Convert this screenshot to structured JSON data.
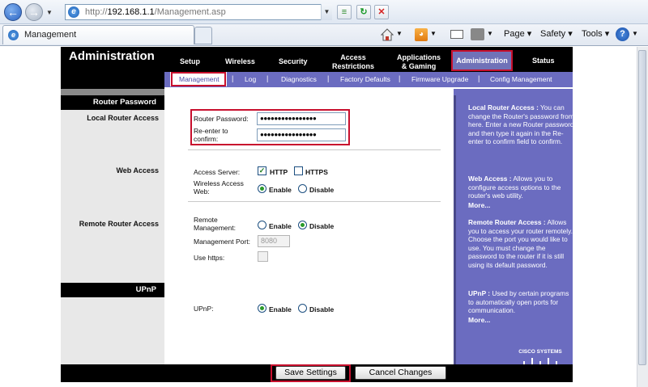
{
  "browser": {
    "address": "http://192.168.1.1/Management.asp",
    "address_host": "192.168.1.1",
    "address_prefix": "http://",
    "address_path": "/Management.asp",
    "tab_title": "Management",
    "menu": [
      "Page",
      "Safety",
      "Tools"
    ]
  },
  "page": {
    "title": "Administration",
    "nav": [
      {
        "label": "Setup"
      },
      {
        "label": "Wireless"
      },
      {
        "label": "Security"
      },
      {
        "label": "Access\nRestrictions"
      },
      {
        "label": "Applications\n& Gaming"
      },
      {
        "label": "Administration"
      },
      {
        "label": "Status"
      }
    ],
    "subnav": [
      "Management",
      "Log",
      "Diagnostics",
      "Factory Defaults",
      "Firmware Upgrade",
      "Config Management"
    ],
    "sections": {
      "router_password": "Router Password",
      "upnp": "UPnP"
    },
    "side_labels": {
      "local_access": "Local Router Access",
      "web_access": "Web Access",
      "remote_access": "Remote Router Access"
    },
    "form": {
      "router_password_label": "Router Password:",
      "router_password_value": "●●●●●●●●●●●●●●●●",
      "reenter_label": "Re-enter to confirm:",
      "reenter_value": "●●●●●●●●●●●●●●●●",
      "access_server_label": "Access Server:",
      "http_label": "HTTP",
      "https_label": "HTTPS",
      "wireless_web_label": "Wireless Access Web:",
      "enable_label": "Enable",
      "disable_label": "Disable",
      "remote_mgmt_label": "Remote Management:",
      "mgmt_port_label": "Management Port:",
      "mgmt_port_value": "8080",
      "use_https_label": "Use https:",
      "upnp_label": "UPnP:"
    },
    "help": {
      "local_title": "Local Router Access :",
      "local_text": " You can change the Router's password from here. Enter a new Router password and then type it again in the Re-enter to confirm field to confirm.",
      "web_title": "Web Access :",
      "web_text": " Allows you to configure access options to the router's web utility.",
      "more1": "More...",
      "remote_title": "Remote Router Access :",
      "remote_text": " Allows you to access your router remotely. Choose the port you would like to use. You must change the password to the router if it is still using its default password.",
      "upnp_title": "UPnP :",
      "upnp_text": " Used by certain programs to automatically open ports for communication.",
      "more2": "More...",
      "logo": "CISCO SYSTEMS"
    },
    "buttons": {
      "save": "Save Settings",
      "cancel": "Cancel Changes"
    },
    "colors": {
      "accent_purple": "#6b6cc0",
      "highlight_red": "#c8102e"
    }
  }
}
